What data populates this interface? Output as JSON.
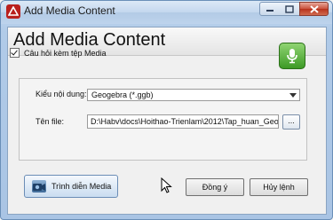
{
  "window": {
    "title": "Add Media Content",
    "controls": {
      "minimize": "minimize",
      "maximize": "maximize",
      "close": "close"
    }
  },
  "dialog": {
    "header": "Add Media Content",
    "attach_checkbox": {
      "label": "Câu hỏi kèm tệp Media",
      "checked": true
    },
    "content_type": {
      "label": "Kiểu nội dung:",
      "selected": "Geogebra (*.ggb)"
    },
    "file": {
      "label": "Tên file:",
      "value": "D:\\Habv\\docs\\Hoithao-Trienlam\\2012\\Tap_huan_Geo",
      "browse_label": "..."
    },
    "present_button": "Trình diễn Media",
    "ok_button": "Đồng ý",
    "cancel_button": "Hủy lệnh"
  },
  "colors": {
    "mic_green": "#3d9a25",
    "close_red": "#c9513c",
    "app_icon_red": "#b9201d"
  }
}
